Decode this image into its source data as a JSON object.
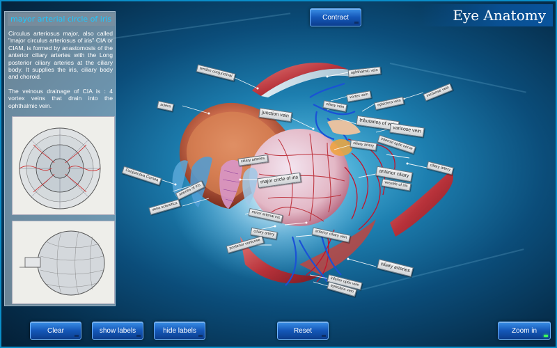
{
  "app_title": "Eye Anatomy",
  "panel": {
    "title": "mayor arterial circle of iris",
    "paragraph1": "Circulus arteriosus major, also called \"major circulus arteriosus of iris\" CIA or CIAM, is formed by anastomosis of the anterior ciliary arteries with the Long posterior ciliary arteries at the ciliary body. It supplies the iris, ciliary body and choroid.",
    "paragraph2": "The veinous drainage of CIA is : 4 vortex veins that drain into the ophthalmic vein."
  },
  "buttons": {
    "contract": "Contract",
    "clear": "Clear",
    "show_labels": "show labels",
    "hide_labels": "hide labels",
    "reset": "Reset",
    "zoom_in": "Zoom in"
  },
  "labels": {
    "tendon_conjunctival": "tendon conjunctival",
    "ophthalmic_vein": "ophthalmic vein",
    "vortex_vein": "vortex vein",
    "ciliary_vein": "ciliary vein",
    "episclera_vein": "episclera vein",
    "vorticose_vein_top": "vorticose vein",
    "sclera": "sclera",
    "junction_vein": "junction vein",
    "tributaries_of_vein": "tributaries of vein",
    "varicose_vein": "varicose vein",
    "ciliary_artery": "ciliary artery",
    "internal_optic_nerve": "internal optic nerve",
    "ciliary_artery_right": "ciliary artery",
    "ciliary_arteries": "ciliary arteries",
    "anterior_ciliary": "anterior ciliary",
    "vessels_of_iris": "vessels of iris",
    "conjunctiva_cornea": "Conjunctiva Cornea",
    "arteries_of_iris": "arteries of iris",
    "major_circle_of_iris": "major circle of iris",
    "vena_sclerotica": "vena sclerotica",
    "minor_arterial_iris": "minor arterial iris",
    "ciliary_artery_low": "ciliary artery",
    "anterior_ciliary_vein": "anterior ciliary vein",
    "posterior_vorticose": "posterior vorticose",
    "ciliary_arteries_bottom": "ciliary arteries",
    "inferior_optic_vein": "inferior optic vein",
    "episclera_vein_bottom": "episclera vein"
  }
}
